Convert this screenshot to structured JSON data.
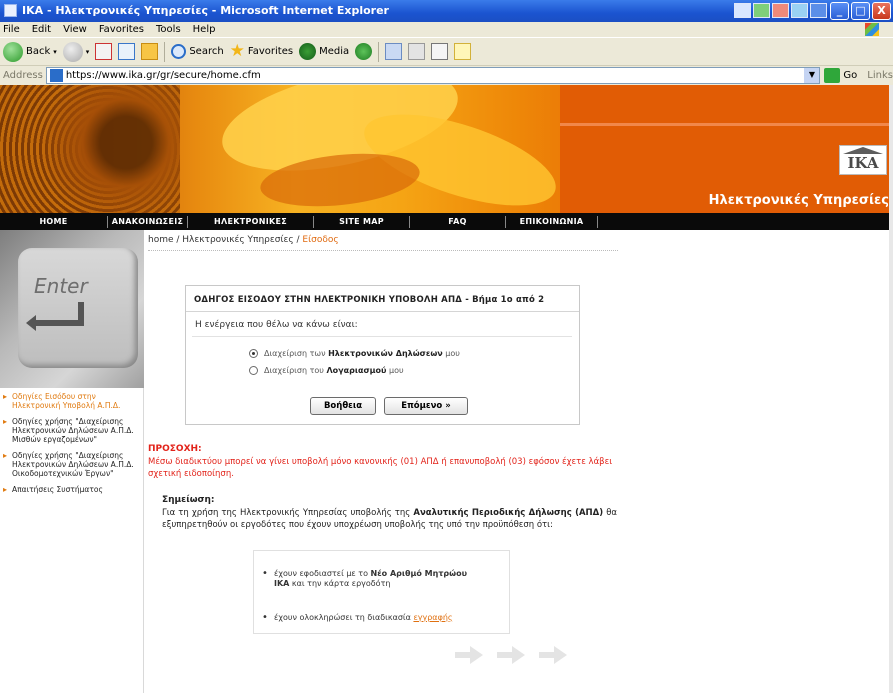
{
  "window": {
    "title": "IKA - Ηλεκτρονικές Υπηρεσίες - Microsoft Internet Explorer",
    "minimize": "_",
    "maximize": "□",
    "close": "X"
  },
  "menu": [
    "File",
    "Edit",
    "View",
    "Favorites",
    "Tools",
    "Help"
  ],
  "toolbar": {
    "back": "Back",
    "search": "Search",
    "favorites": "Favorites",
    "media": "Media"
  },
  "address": {
    "label": "Address",
    "url": "https://www.ika.gr/gr/secure/home.cfm",
    "go": "Go",
    "links": "Links"
  },
  "banner": {
    "logo": "IKA",
    "caption": "Ηλεκτρονικές Υπηρεσίες"
  },
  "nav": [
    "HOME",
    "ΑΝΑΚΟΙΝΩΣΕΙΣ",
    "ΗΛΕΚΤΡΟΝΙΚΕΣ ΥΠΗΡΕΣΙΕΣ",
    "SITE MAP",
    "FAQ",
    "ΕΠΙΚΟΙΝΩΝΙΑ"
  ],
  "enter_key": "Enter",
  "sidenav": [
    "Οδηγίες Εισόδου στην Ηλεκτρονική Υποβολή Α.Π.Δ.",
    "Οδηγίες χρήσης \"Διαχείρισης Ηλεκτρονικών Δηλώσεων Α.Π.Δ. Μισθών εργαζομένων\"",
    "Οδηγίες χρήσης \"Διαχείρισης Ηλεκτρονικών Δηλώσεων Α.Π.Δ. Οικοδομοτεχνικών Έργων\"",
    "Απαιτήσεις Συστήματος"
  ],
  "breadcrumb": {
    "path": "home / Ηλεκτρονικές Υπηρεσίες / ",
    "current": "Είσοδος"
  },
  "dialog": {
    "title": "ΟΔΗΓΟΣ ΕΙΣΟΔΟΥ ΣΤΗΝ ΗΛΕΚΤΡΟΝΙΚΗ ΥΠΟΒΟΛΗ ΑΠΔ - Βήμα 1ο από 2",
    "prompt": "Η ενέργεια που θέλω να κάνω είναι:",
    "option1_prefix": "Διαχείριση των ",
    "option1_bold": "Ηλεκτρονικών Δηλώσεων",
    "option1_suffix": " μου",
    "option2_prefix": "Διαχείριση του ",
    "option2_bold": "Λογαριασμού",
    "option2_suffix": " μου",
    "help_button": "Βοήθεια",
    "next_button": "Επόμενο »"
  },
  "notice": {
    "title": "ΠΡΟΣΟΧΗ:",
    "body": "Μέσω διαδικτύου μπορεί να γίνει υποβολή μόνο κανονικής (01) ΑΠΔ ή επανυποβολή (03) εφόσον έχετε λάβει σχετική ειδοποίηση."
  },
  "note": {
    "title": "Σημείωση:",
    "body_prefix": "Για τη χρήση της Ηλεκτρονικής Υπηρεσίας υποβολής της ",
    "body_bold": "Αναλυτικής Περιοδικής Δήλωσης (ΑΠΔ)",
    "body_suffix": " θα εξυπηρετηθούν οι εργοδότες που έχουν υποχρέωση υποβολής της υπό την προϋπόθεση ότι:"
  },
  "requirements": {
    "r1_prefix": "έχουν εφοδιαστεί με το ",
    "r1_bold": "Νέο Αριθμό Μητρώου ΙΚΑ",
    "r1_suffix": " και την κάρτα εργοδότη",
    "r2_prefix": "έχουν ολοκληρώσει τη διαδικασία ",
    "r2_link": "εγγραφής"
  }
}
